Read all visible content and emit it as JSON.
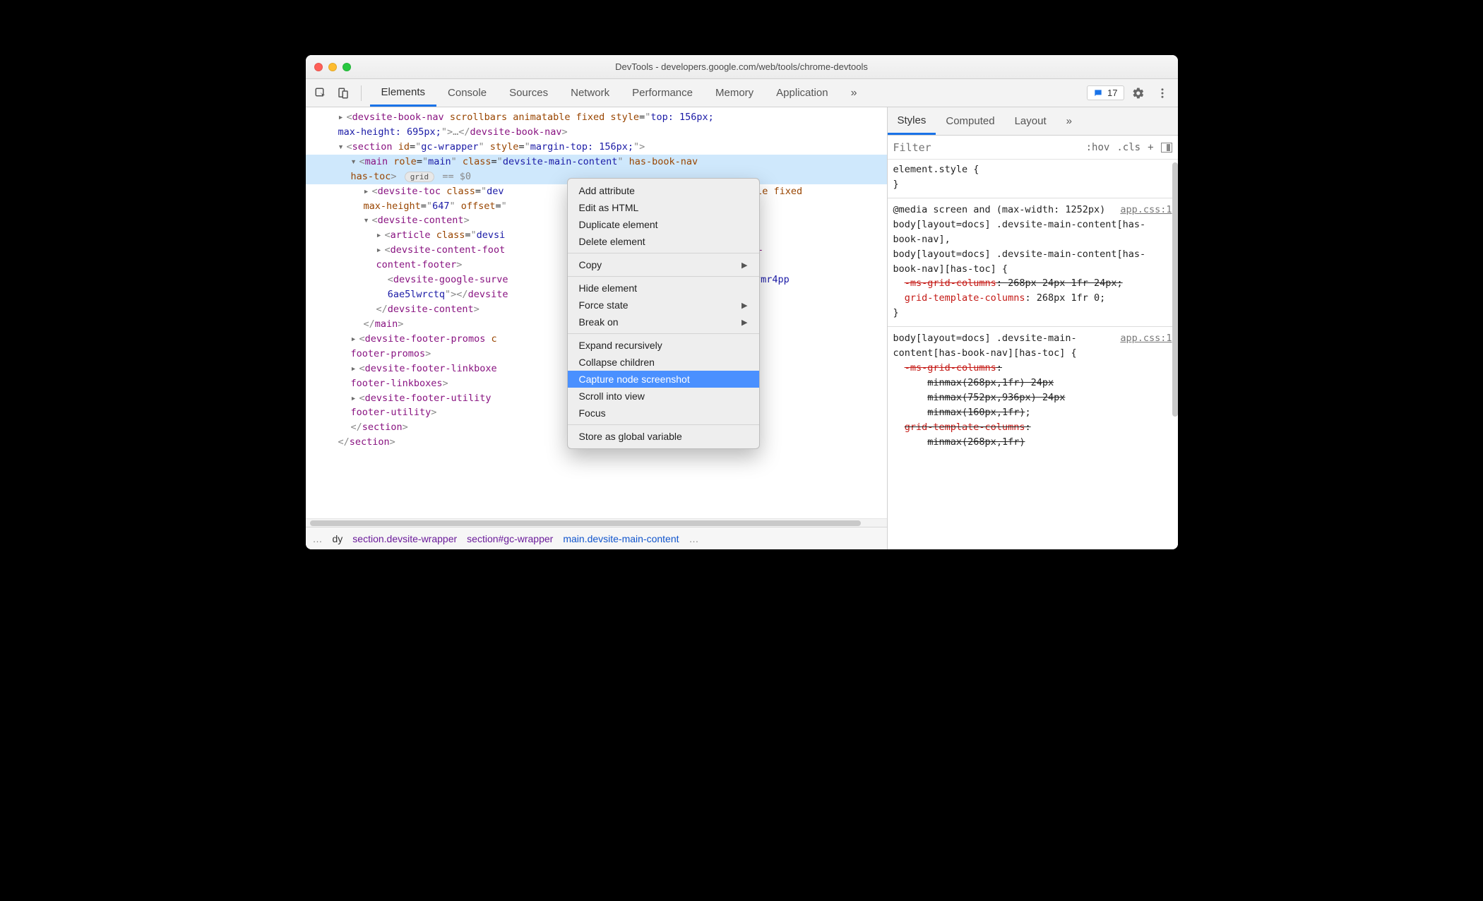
{
  "window": {
    "title": "DevTools - developers.google.com/web/tools/chrome-devtools"
  },
  "toolbar": {
    "tabs": [
      "Elements",
      "Console",
      "Sources",
      "Network",
      "Performance",
      "Memory",
      "Application"
    ],
    "more_glyph": "»",
    "issue_count": "17"
  },
  "breadcrumbs": {
    "left_ellipsis": "…",
    "items": [
      "dy",
      "section.devsite-wrapper",
      "section#gc-wrapper",
      "main.devsite-main-content"
    ],
    "right_ellipsis": "…"
  },
  "dom": {
    "l1_open": "<devsite-book-nav scrollbars animatable fixed style=\"top: 156px; max-height: 695px;\">…</devsite-book-nav>",
    "section_open": "<section id=\"gc-wrapper\" style=\"margin-top: 156px;\">",
    "main_open": "<main role=\"main\" class=\"devsite-main-content\" has-book-nav has-toc>",
    "grid_pill": "grid",
    "eqzero": " == $0",
    "toc": "<devsite-toc class=\"devsite-toc-embedded=\"\" visible fixed max-height=\"647\" offset=\"",
    "content_open": "<devsite-content>",
    "article": "<article class=\"devsi",
    "footer": "<devsite-content-foot",
    "footer2": "devsite-content-footer>",
    "survey": "<devsite-google-surve",
    "survey_tail": "j5ifxusvvmr4pp",
    "survey2": "6ae5lwrctq\"></devsite",
    "content_close": "</devsite-content>",
    "main_close": "</main>",
    "fpromos": "<devsite-footer-promos c",
    "fpromos2": "devsite-footer-promos>",
    "flink": "<devsite-footer-linkboxe",
    "flink_tail": "…</devsite-footer-linkboxes>",
    "futil": "<devsite-footer-utility ",
    "futil_tail": "/devsite-footer-utility>",
    "section_close": "</section>",
    "section_close2": "</section>"
  },
  "contextmenu": {
    "items": [
      {
        "label": "Add attribute"
      },
      {
        "label": "Edit as HTML"
      },
      {
        "label": "Duplicate element"
      },
      {
        "label": "Delete element"
      },
      {
        "sep": true
      },
      {
        "label": "Copy",
        "sub": true
      },
      {
        "sep": true
      },
      {
        "label": "Hide element"
      },
      {
        "label": "Force state",
        "sub": true
      },
      {
        "label": "Break on",
        "sub": true
      },
      {
        "sep": true
      },
      {
        "label": "Expand recursively"
      },
      {
        "label": "Collapse children"
      },
      {
        "label": "Capture node screenshot",
        "selected": true
      },
      {
        "label": "Scroll into view"
      },
      {
        "label": "Focus"
      },
      {
        "sep": true
      },
      {
        "label": "Store as global variable"
      }
    ]
  },
  "sidebar": {
    "tabs": [
      "Styles",
      "Computed",
      "Layout"
    ],
    "more_glyph": "»",
    "filter_placeholder": "Filter",
    "hov": ":hov",
    "cls": ".cls",
    "plus": "+",
    "block1_sel": "element.style {",
    "block1_close": "}",
    "media": "@media screen and (max-width: 1252px)",
    "src1": "app.css:1",
    "sel2a": "body[layout=docs] .devsite-main-content[has-book-nav],",
    "sel2b": "body[layout=docs] .devsite-main-content[has-book-nav][has-toc] {",
    "prop_ms": "-ms-grid-columns",
    "val_ms": "268px 24px 1fr 24px",
    "prop_gtc": "grid-template-columns",
    "val_gtc": "268px 1fr 0",
    "close2": "}",
    "src2": "app.css:1",
    "sel3": "body[layout=docs] .devsite-main-content[has-book-nav][has-toc] {",
    "prop_ms2": "-ms-grid-columns",
    "mm1": "minmax(268px,1fr) 24px",
    "mm2": "minmax(752px,936px) 24px",
    "mm3": "minmax(160px,1fr)",
    "prop_gtc2": "grid-template-columns",
    "mm4": "minmax(268px,1fr)"
  }
}
